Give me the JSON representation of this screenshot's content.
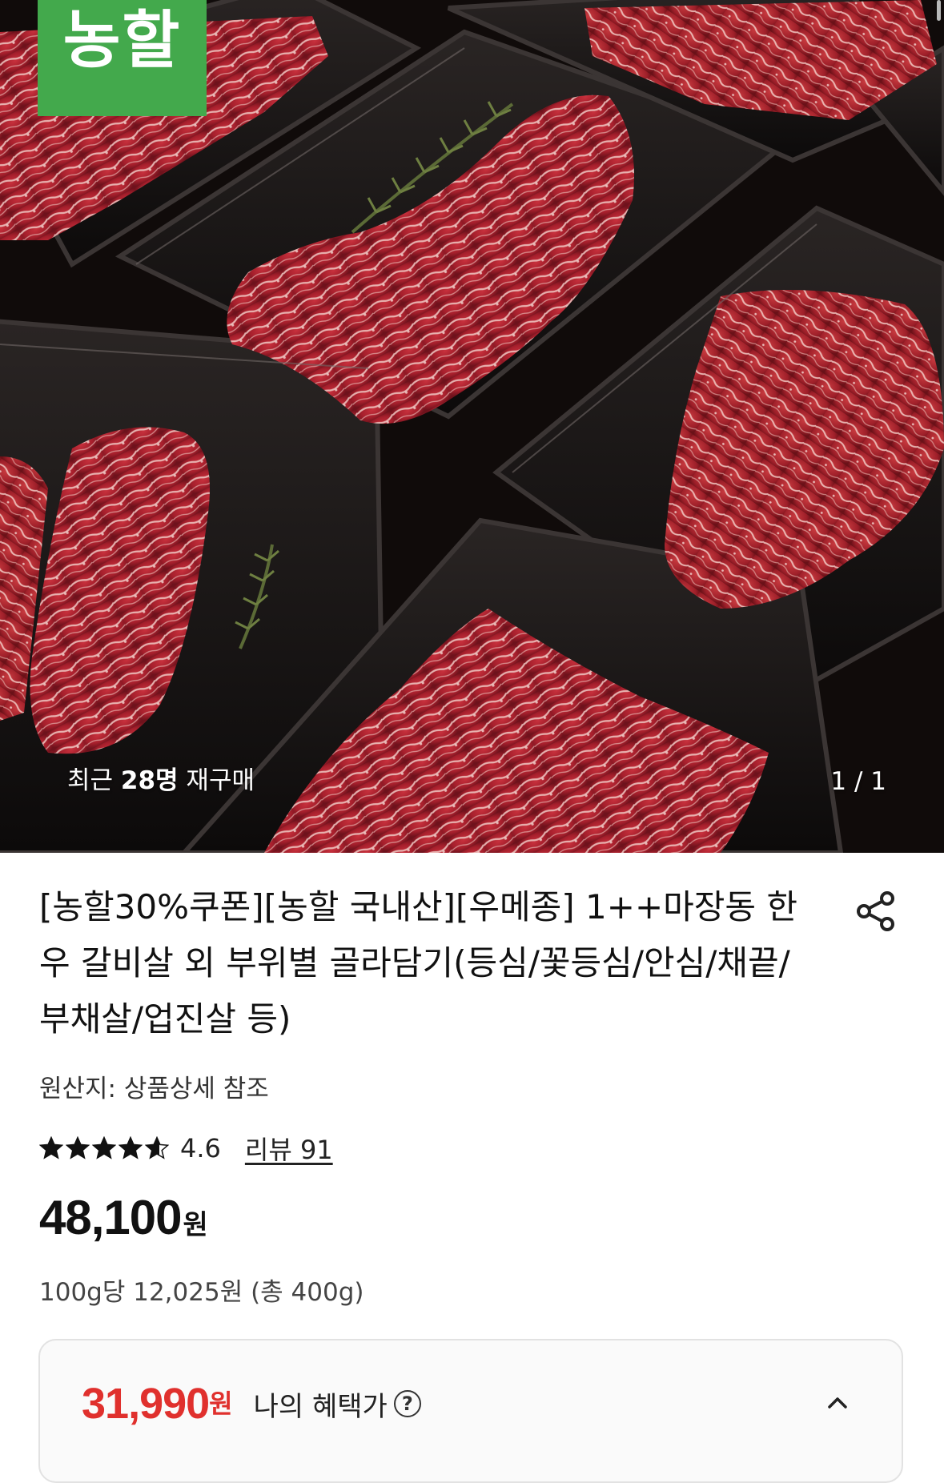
{
  "hero": {
    "brand_badge": "농할",
    "repurchase_prefix": "최근 ",
    "repurchase_count": "28명",
    "repurchase_suffix": " 재구매",
    "page_counter": "1 / 1"
  },
  "product": {
    "title": "[농할30%쿠폰][농할 국내산][우메종] 1++마장동 한우 갈비살 외 부위별 골라담기(등심/꽃등심/안심/채끝/부채살/업진살 등)",
    "origin": "원산지: 상품상세 참조",
    "rating": {
      "value": "4.6",
      "stars": 4.6,
      "review_label": "리뷰 91"
    },
    "price": {
      "amount": "48,100",
      "currency": "원"
    },
    "unit_price": "100g당 12,025원 (총 400g)"
  },
  "benefit": {
    "amount": "31,990",
    "currency": "원",
    "label": "나의 혜택가",
    "help_symbol": "?"
  },
  "colors": {
    "brand_green": "#43a94c",
    "benefit_red": "#e0302d"
  },
  "icons": {
    "share": "share-icon",
    "help": "help-icon",
    "collapse": "chevron-up-icon"
  }
}
